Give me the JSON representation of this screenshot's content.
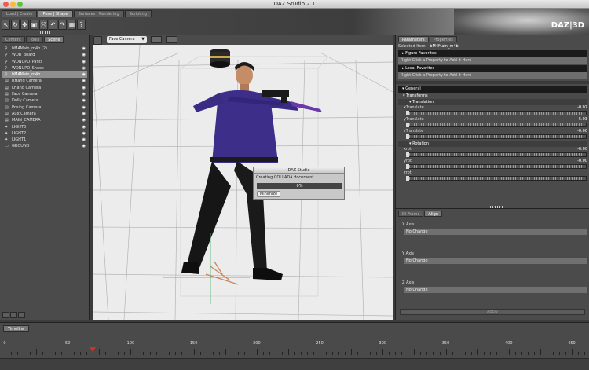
{
  "window": {
    "title": "DAZ Studio 2.1"
  },
  "brand": {
    "logo": "DAZ|3D"
  },
  "workspace_tabs": [
    "Load | Create",
    "Pose | Shape",
    "Surfaces | Rendering",
    "Scripting"
  ],
  "active_workspace_tab": 1,
  "toolbar": {
    "tools": [
      "pointer-icon",
      "rotate-icon",
      "translate-icon",
      "scale-icon",
      "universal-icon",
      "undo-icon",
      "redo-icon",
      "render-icon",
      "help-icon"
    ],
    "tool_glyphs": [
      "↖",
      "↻",
      "✥",
      "▣",
      "⤧",
      "↶",
      "↷",
      "▦",
      "?"
    ]
  },
  "left_panel": {
    "tabs": [
      "Content",
      "Tools",
      "Scene"
    ],
    "active_tab": 2,
    "items": [
      {
        "label": "bM4Main_m4b (2)",
        "icon": "figure-icon"
      },
      {
        "label": "WDB_Board",
        "icon": "figure-icon"
      },
      {
        "label": "WDNUPO_Pants",
        "icon": "figure-icon"
      },
      {
        "label": "WDNUPO_Shoes",
        "icon": "figure-icon"
      },
      {
        "label": "bM4Main_m4b",
        "icon": "figure-icon",
        "selected": true
      },
      {
        "label": "RHand Camera",
        "icon": "camera-icon"
      },
      {
        "label": "LHand Camera",
        "icon": "camera-icon"
      },
      {
        "label": "Face Camera",
        "icon": "camera-icon"
      },
      {
        "label": "Dolly Camera",
        "icon": "camera-icon"
      },
      {
        "label": "Posing Camera",
        "icon": "camera-icon"
      },
      {
        "label": "Aux Camera",
        "icon": "camera-icon"
      },
      {
        "label": "MAIN_CAMERA",
        "icon": "camera-icon"
      },
      {
        "label": "LIGHT3",
        "icon": "light-icon"
      },
      {
        "label": "LIGHT2",
        "icon": "light-icon"
      },
      {
        "label": "LIGHT1",
        "icon": "light-icon"
      },
      {
        "label": "GROUND",
        "icon": "ground-icon"
      }
    ]
  },
  "viewport": {
    "camera": "Face Camera"
  },
  "dialog": {
    "title": "DAZ Studio",
    "message": "Creating COLLADA document...",
    "progress": "0%",
    "progress_fraction": 0,
    "button": "Minimize"
  },
  "parameters": {
    "tabs": [
      "Parameters",
      "Properties"
    ],
    "active_tab": 0,
    "selected_label": "Selected Item:",
    "selected_value": "bM4Main_m4b",
    "figure_favorites": "Figure Favorites",
    "figure_hint": "Right Click a Property to Add it Here",
    "local_favorites": "Local Favorites",
    "local_hint": "Right Click a Property to Add it Here",
    "general": "General",
    "transforms": "Transforms",
    "translation": "Translation",
    "rotation": "Rotation",
    "props": [
      {
        "name": "xTranslate",
        "value": "-0.07"
      },
      {
        "name": "yTranslate",
        "value": "5.03"
      },
      {
        "name": "zTranslate",
        "value": "-0.00"
      }
    ],
    "rot_props": [
      {
        "name": "xrot",
        "value": "-0.00"
      },
      {
        "name": "yrot",
        "value": "-0.00"
      },
      {
        "name": "zrot",
        "value": ""
      }
    ]
  },
  "align_panel": {
    "tabs": [
      "Di Frame",
      "Align"
    ],
    "active_tab": 1,
    "x_label": "X Axis",
    "x_value": "No Change",
    "y_label": "Y Axis",
    "y_value": "No Change",
    "z_label": "Z Axis",
    "z_value": "No Change",
    "apply": "Apply"
  },
  "timeline": {
    "tab": "Timeline",
    "current_frame": 30,
    "max_frame": 460,
    "labels": [
      "0",
      "50",
      "100",
      "150",
      "200",
      "250",
      "300",
      "350",
      "400",
      "450"
    ]
  },
  "colors": {
    "accent_selection": "#8f8f8f",
    "shirt": "#3d2e8a",
    "scrub": "#c0392b"
  }
}
